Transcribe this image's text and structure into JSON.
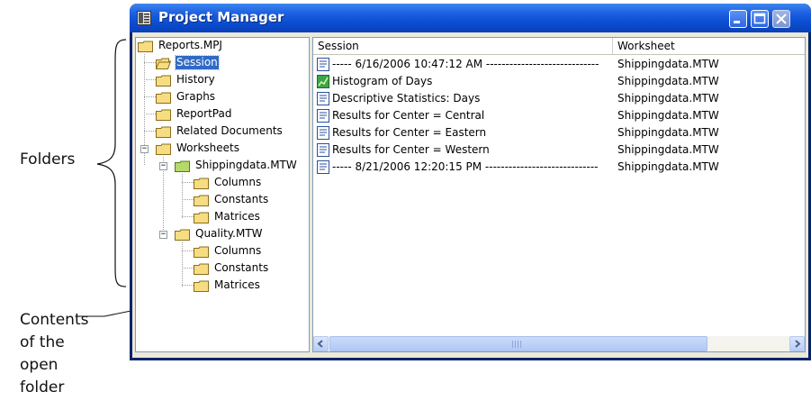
{
  "window": {
    "title": "Project Manager",
    "icon": "project-manager-icon",
    "buttons": [
      "minimize",
      "maximize",
      "close"
    ]
  },
  "annotations": {
    "folders_label": "Folders",
    "contents_lines": [
      "Contents",
      "of the",
      "open",
      "folder"
    ]
  },
  "tree": {
    "root": "Reports.MPJ",
    "items": [
      {
        "label": "Session",
        "selected": true
      },
      {
        "label": "History"
      },
      {
        "label": "Graphs"
      },
      {
        "label": "ReportPad"
      },
      {
        "label": "Related Documents"
      },
      {
        "label": "Worksheets"
      },
      {
        "label": "Shippingdata.MTW"
      },
      {
        "label": "Columns"
      },
      {
        "label": "Constants"
      },
      {
        "label": "Matrices"
      },
      {
        "label": "Quality.MTW"
      },
      {
        "label": "Columns"
      },
      {
        "label": "Constants"
      },
      {
        "label": "Matrices"
      }
    ]
  },
  "list": {
    "columns": [
      "Session",
      "Worksheet"
    ],
    "rows": [
      {
        "icon": "text-document-icon",
        "session": "----- 6/16/2006 10:47:12 AM -----------------------------",
        "worksheet": "Shippingdata.MTW"
      },
      {
        "icon": "graph-icon",
        "session": "Histogram of Days",
        "worksheet": "Shippingdata.MTW"
      },
      {
        "icon": "text-document-icon",
        "session": "Descriptive Statistics: Days",
        "worksheet": "Shippingdata.MTW"
      },
      {
        "icon": "text-document-icon",
        "session": "Results for Center = Central",
        "worksheet": "Shippingdata.MTW"
      },
      {
        "icon": "text-document-icon",
        "session": "Results for Center = Eastern",
        "worksheet": "Shippingdata.MTW"
      },
      {
        "icon": "text-document-icon",
        "session": "Results for Center = Western",
        "worksheet": "Shippingdata.MTW"
      },
      {
        "icon": "text-document-icon",
        "session": "----- 8/21/2006 12:20:15 PM -----------------------------",
        "worksheet": "Shippingdata.MTW"
      }
    ]
  },
  "colors": {
    "titlebar": "#0a4ccf",
    "selection": "#316ac5",
    "folder": "#f5d76e"
  }
}
